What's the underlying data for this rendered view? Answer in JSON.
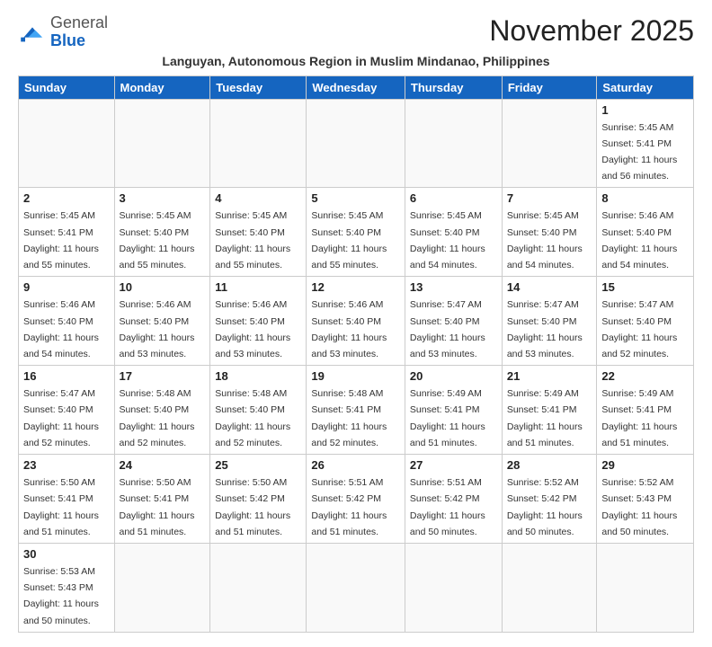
{
  "title": "November 2025",
  "subtitle": "Languyan, Autonomous Region in Muslim Mindanao, Philippines",
  "logo": {
    "general": "General",
    "blue": "Blue"
  },
  "headers": [
    "Sunday",
    "Monday",
    "Tuesday",
    "Wednesday",
    "Thursday",
    "Friday",
    "Saturday"
  ],
  "days": {
    "d1": {
      "num": "1",
      "info": "Sunrise: 5:45 AM\nSunset: 5:41 PM\nDaylight: 11 hours\nand 56 minutes."
    },
    "d2": {
      "num": "2",
      "info": "Sunrise: 5:45 AM\nSunset: 5:41 PM\nDaylight: 11 hours\nand 55 minutes."
    },
    "d3": {
      "num": "3",
      "info": "Sunrise: 5:45 AM\nSunset: 5:40 PM\nDaylight: 11 hours\nand 55 minutes."
    },
    "d4": {
      "num": "4",
      "info": "Sunrise: 5:45 AM\nSunset: 5:40 PM\nDaylight: 11 hours\nand 55 minutes."
    },
    "d5": {
      "num": "5",
      "info": "Sunrise: 5:45 AM\nSunset: 5:40 PM\nDaylight: 11 hours\nand 55 minutes."
    },
    "d6": {
      "num": "6",
      "info": "Sunrise: 5:45 AM\nSunset: 5:40 PM\nDaylight: 11 hours\nand 54 minutes."
    },
    "d7": {
      "num": "7",
      "info": "Sunrise: 5:45 AM\nSunset: 5:40 PM\nDaylight: 11 hours\nand 54 minutes."
    },
    "d8": {
      "num": "8",
      "info": "Sunrise: 5:46 AM\nSunset: 5:40 PM\nDaylight: 11 hours\nand 54 minutes."
    },
    "d9": {
      "num": "9",
      "info": "Sunrise: 5:46 AM\nSunset: 5:40 PM\nDaylight: 11 hours\nand 54 minutes."
    },
    "d10": {
      "num": "10",
      "info": "Sunrise: 5:46 AM\nSunset: 5:40 PM\nDaylight: 11 hours\nand 53 minutes."
    },
    "d11": {
      "num": "11",
      "info": "Sunrise: 5:46 AM\nSunset: 5:40 PM\nDaylight: 11 hours\nand 53 minutes."
    },
    "d12": {
      "num": "12",
      "info": "Sunrise: 5:46 AM\nSunset: 5:40 PM\nDaylight: 11 hours\nand 53 minutes."
    },
    "d13": {
      "num": "13",
      "info": "Sunrise: 5:47 AM\nSunset: 5:40 PM\nDaylight: 11 hours\nand 53 minutes."
    },
    "d14": {
      "num": "14",
      "info": "Sunrise: 5:47 AM\nSunset: 5:40 PM\nDaylight: 11 hours\nand 53 minutes."
    },
    "d15": {
      "num": "15",
      "info": "Sunrise: 5:47 AM\nSunset: 5:40 PM\nDaylight: 11 hours\nand 52 minutes."
    },
    "d16": {
      "num": "16",
      "info": "Sunrise: 5:47 AM\nSunset: 5:40 PM\nDaylight: 11 hours\nand 52 minutes."
    },
    "d17": {
      "num": "17",
      "info": "Sunrise: 5:48 AM\nSunset: 5:40 PM\nDaylight: 11 hours\nand 52 minutes."
    },
    "d18": {
      "num": "18",
      "info": "Sunrise: 5:48 AM\nSunset: 5:40 PM\nDaylight: 11 hours\nand 52 minutes."
    },
    "d19": {
      "num": "19",
      "info": "Sunrise: 5:48 AM\nSunset: 5:41 PM\nDaylight: 11 hours\nand 52 minutes."
    },
    "d20": {
      "num": "20",
      "info": "Sunrise: 5:49 AM\nSunset: 5:41 PM\nDaylight: 11 hours\nand 51 minutes."
    },
    "d21": {
      "num": "21",
      "info": "Sunrise: 5:49 AM\nSunset: 5:41 PM\nDaylight: 11 hours\nand 51 minutes."
    },
    "d22": {
      "num": "22",
      "info": "Sunrise: 5:49 AM\nSunset: 5:41 PM\nDaylight: 11 hours\nand 51 minutes."
    },
    "d23": {
      "num": "23",
      "info": "Sunrise: 5:50 AM\nSunset: 5:41 PM\nDaylight: 11 hours\nand 51 minutes."
    },
    "d24": {
      "num": "24",
      "info": "Sunrise: 5:50 AM\nSunset: 5:41 PM\nDaylight: 11 hours\nand 51 minutes."
    },
    "d25": {
      "num": "25",
      "info": "Sunrise: 5:50 AM\nSunset: 5:42 PM\nDaylight: 11 hours\nand 51 minutes."
    },
    "d26": {
      "num": "26",
      "info": "Sunrise: 5:51 AM\nSunset: 5:42 PM\nDaylight: 11 hours\nand 51 minutes."
    },
    "d27": {
      "num": "27",
      "info": "Sunrise: 5:51 AM\nSunset: 5:42 PM\nDaylight: 11 hours\nand 50 minutes."
    },
    "d28": {
      "num": "28",
      "info": "Sunrise: 5:52 AM\nSunset: 5:42 PM\nDaylight: 11 hours\nand 50 minutes."
    },
    "d29": {
      "num": "29",
      "info": "Sunrise: 5:52 AM\nSunset: 5:43 PM\nDaylight: 11 hours\nand 50 minutes."
    },
    "d30": {
      "num": "30",
      "info": "Sunrise: 5:53 AM\nSunset: 5:43 PM\nDaylight: 11 hours\nand 50 minutes."
    }
  }
}
